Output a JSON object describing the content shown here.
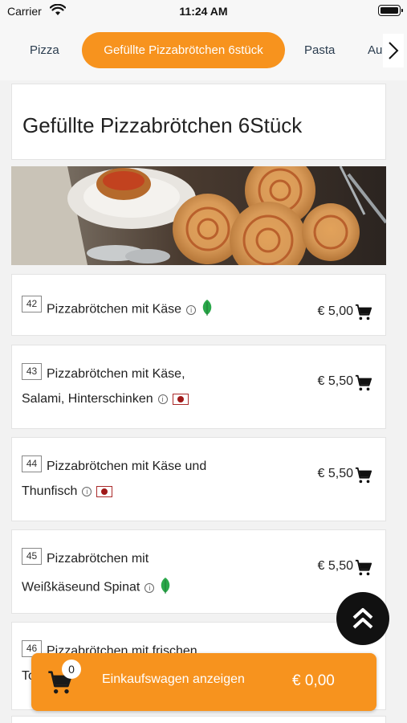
{
  "status_bar": {
    "carrier": "Carrier",
    "time": "11:24 AM"
  },
  "tabs": [
    {
      "label": "Pizza",
      "active": false
    },
    {
      "label": "Gefüllte Pizzabrötchen 6stück",
      "active": true
    },
    {
      "label": "Pasta",
      "active": false
    },
    {
      "label": "Au",
      "active": false
    }
  ],
  "category": {
    "title": "Gefüllte Pizzabrötchen 6Stück"
  },
  "items": [
    {
      "number": "42",
      "line1": "Pizzabrötchen mit Käse",
      "line2": "",
      "tag": "vegetarian",
      "price": "€ 5,00"
    },
    {
      "number": "43",
      "line1": "Pizzabrötchen mit Käse,",
      "line2": "Salami, Hinterschinken",
      "tag": "meat",
      "price": "€ 5,50"
    },
    {
      "number": "44",
      "line1": "Pizzabrötchen mit Käse und",
      "line2": "Thunfisch",
      "tag": "meat",
      "price": "€ 5,50"
    },
    {
      "number": "45",
      "line1": "Pizzabrötchen mit",
      "line2": "Weißkäseund Spinat",
      "tag": "vegetarian",
      "price": "€ 5,50"
    },
    {
      "number": "46",
      "line1": "Pizzabrötchen mit frischen",
      "line2": "To",
      "tag": "",
      "price": ""
    }
  ],
  "cart": {
    "count": "0",
    "label": "Einkaufswagen anzeigen",
    "total": "€ 0,00"
  },
  "colors": {
    "accent": "#f7931e",
    "veg": "#2aa84a",
    "meat": "#a01818"
  },
  "icons": [
    "wifi-icon",
    "battery-icon",
    "chevron-right-icon",
    "info-icon",
    "leaf-icon",
    "meat-icon",
    "cart-icon",
    "double-chevron-up-icon"
  ]
}
